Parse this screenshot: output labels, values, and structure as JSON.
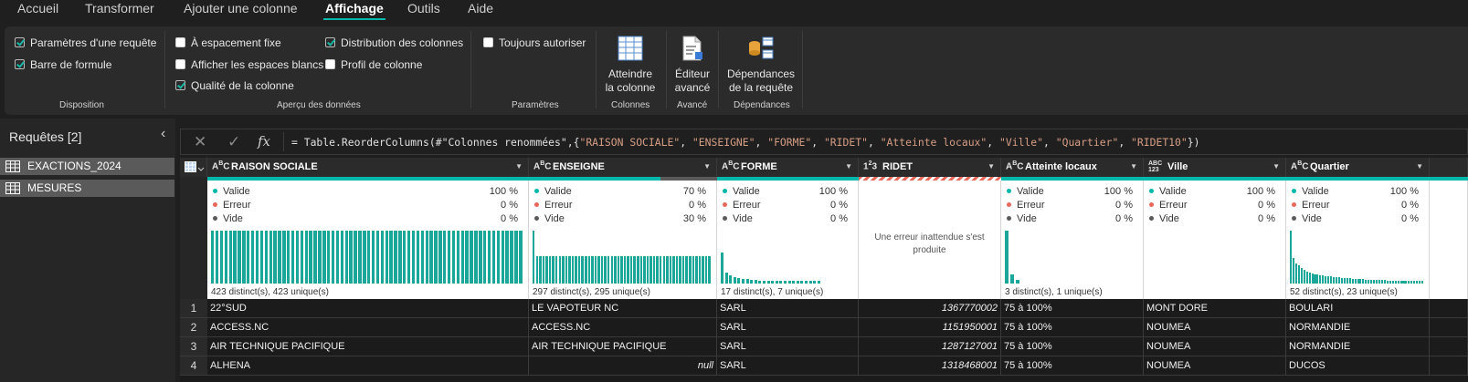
{
  "tabs": [
    "Accueil",
    "Transformer",
    "Ajouter une colonne",
    "Affichage",
    "Outils",
    "Aide"
  ],
  "active_tab": "Affichage",
  "ribbon": {
    "disposition": {
      "label": "Disposition",
      "checks": [
        {
          "label": "Paramètres d'une requête",
          "checked": true
        },
        {
          "label": "Barre de formule",
          "checked": true
        }
      ]
    },
    "apercu": {
      "label": "Aperçu des données",
      "checks": [
        {
          "label": "À espacement fixe",
          "checked": false
        },
        {
          "label": "Afficher les espaces blancs",
          "checked": false
        },
        {
          "label": "Qualité de la colonne",
          "checked": true
        },
        {
          "label": "Distribution des colonnes",
          "checked": true
        },
        {
          "label": "Profil de colonne",
          "checked": false
        }
      ]
    },
    "parametres": {
      "label": "Paramètres",
      "checks": [
        {
          "label": "Toujours autoriser",
          "checked": false
        }
      ]
    },
    "colonnes": {
      "label": "Colonnes",
      "button_line1": "Atteindre",
      "button_line2": "la colonne"
    },
    "avance": {
      "label": "Avancé",
      "button_line1": "Éditeur",
      "button_line2": "avancé"
    },
    "dependances": {
      "label": "Dépendances",
      "button_line1": "Dépendances",
      "button_line2": "de la requête"
    }
  },
  "queries": {
    "title": "Requêtes [2]",
    "items": [
      "EXACTIONS_2024",
      "MESURES"
    ]
  },
  "formula": {
    "fx": "fx",
    "prefix": "= Table.ReorderColumns(#\"Colonnes renommées\",{",
    "strings": [
      "\"RAISON SOCIALE\"",
      "\"ENSEIGNE\"",
      "\"FORME\"",
      "\"RIDET\"",
      "\"Atteinte locaux\"",
      "\"Ville\"",
      "\"Quartier\"",
      "\"RIDET10\""
    ],
    "suffix": "})"
  },
  "columns": [
    {
      "type": "ABC",
      "name": "RAISON SOCIALE",
      "valide": "100 %",
      "erreur": "0 %",
      "vide": "0 %",
      "footer": "423 distinct(s), 423 unique(s)"
    },
    {
      "type": "ABC",
      "name": "ENSEIGNE",
      "valide": "70 %",
      "erreur": "0 %",
      "vide": "30 %",
      "footer": "297 distinct(s), 295 unique(s)"
    },
    {
      "type": "ABC",
      "name": "FORME",
      "valide": "100 %",
      "erreur": "0 %",
      "vide": "0 %",
      "footer": "17 distinct(s), 7 unique(s)"
    },
    {
      "type": "123",
      "name": "RIDET",
      "error_message": "Une erreur inattendue s'est produite"
    },
    {
      "type": "ABC",
      "name": "Atteinte locaux",
      "valide": "100 %",
      "erreur": "0 %",
      "vide": "0 %",
      "footer": "3 distinct(s), 1 unique(s)"
    },
    {
      "type": "ABC123",
      "name": "Ville",
      "valide": "100 %",
      "erreur": "0 %",
      "vide": "0 %",
      "footer": ""
    },
    {
      "type": "ABC",
      "name": "Quartier",
      "valide": "100 %",
      "erreur": "0 %",
      "vide": "0 %",
      "footer": "52 distinct(s), 23 unique(s)"
    }
  ],
  "quality_labels": {
    "valide": "Valide",
    "erreur": "Erreur",
    "vide": "Vide"
  },
  "colors": {
    "valid": "#01b8aa",
    "error": "#e8685a",
    "empty": "#5a5a5a",
    "accent": "#01b8aa"
  },
  "rows": [
    {
      "n": "1",
      "cells": [
        "22°SUD",
        "LE VAPOTEUR NC",
        "SARL",
        "1367770002",
        "75 à 100%",
        "MONT DORE",
        "BOULARI"
      ]
    },
    {
      "n": "2",
      "cells": [
        "ACCESS.NC",
        "ACCESS.NC",
        "SARL",
        "1151950001",
        "75 à 100%",
        "NOUMEA",
        "NORMANDIE"
      ]
    },
    {
      "n": "3",
      "cells": [
        "AIR TECHNIQUE PACIFIQUE",
        "AIR TECHNIQUE PACIFIQUE",
        "SARL",
        "1287127001",
        "75 à 100%",
        "NOUMEA",
        "NORMANDIE"
      ]
    },
    {
      "n": "4",
      "cells": [
        "ALHENA",
        "null",
        "SARL",
        "1318468001",
        "75 à 100%",
        "NOUMEA",
        "DUCOS"
      ]
    }
  ]
}
